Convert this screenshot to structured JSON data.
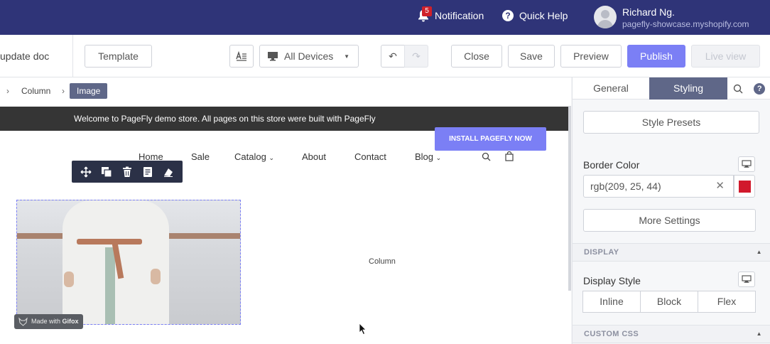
{
  "topbar": {
    "notification_label": "Notification",
    "notification_count": "5",
    "quick_help_label": "Quick Help",
    "user_name": "Richard Ng.",
    "store_domain": "pagefly-showcase.myshopify.com"
  },
  "toolbar": {
    "doc_title": "update doc",
    "template_label": "Template",
    "device_label": "All Devices",
    "close_label": "Close",
    "save_label": "Save",
    "preview_label": "Preview",
    "publish_label": "Publish",
    "live_view_label": "Live view",
    "undo_glyph": "↶",
    "redo_glyph": "↷"
  },
  "breadcrumb": {
    "items": [
      "Column",
      "Image"
    ]
  },
  "canvas": {
    "welcome_text": "Welcome to PageFly demo store. All pages on this store were built with PageFly",
    "install_button": "INSTALL PAGEFLY NOW",
    "nav": [
      "Home",
      "Sale",
      "Catalog",
      "About",
      "Contact",
      "Blog"
    ],
    "column_label": "Column",
    "gifox_prefix": "Made with ",
    "gifox_brand": "Gifox"
  },
  "panel": {
    "tabs": [
      "General",
      "Styling"
    ],
    "active_tab": "Styling",
    "style_presets_label": "Style Presets",
    "border_color_label": "Border Color",
    "border_color_value": "rgb(209, 25, 44)",
    "border_color_hex": "#d1192c",
    "more_settings_label": "More Settings",
    "display_section": "DISPLAY",
    "display_style_label": "Display Style",
    "display_options": [
      "Inline",
      "Block",
      "Flex"
    ],
    "custom_css_section": "CUSTOM CSS"
  },
  "colors": {
    "header_bg": "#2f3478",
    "accent": "#7b7ff5",
    "active_tab": "#5f6788"
  }
}
